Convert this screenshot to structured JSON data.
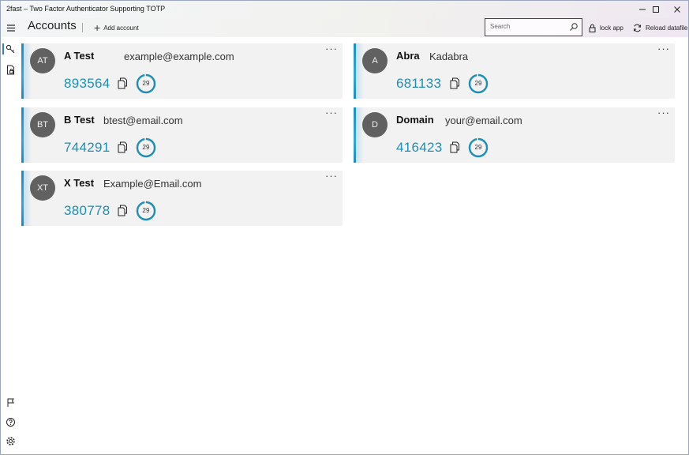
{
  "window": {
    "title": "2fast – Two Factor Authenticator Supporting TOTP"
  },
  "header": {
    "page_title": "Accounts",
    "add_account_label": "Add account",
    "search_placeholder": "Search",
    "lock_label": "lock app",
    "reload_label": "Reload datafile"
  },
  "colors": {
    "accent": "#1e8fb4",
    "avatar_bg": "#616161",
    "card_bg": "#f2f2f2"
  },
  "accounts": [
    {
      "initials": "AT",
      "label": "A Test",
      "account": "example@example.com",
      "code": "893564",
      "seconds": "29"
    },
    {
      "initials": "A",
      "label": "Abra",
      "account": "Kadabra",
      "code": "681133",
      "seconds": "29"
    },
    {
      "initials": "BT",
      "label": "B Test",
      "account": "btest@email.com",
      "code": "744291",
      "seconds": "29"
    },
    {
      "initials": "D",
      "label": "Domain",
      "account": "your@email.com",
      "code": "416423",
      "seconds": "29"
    },
    {
      "initials": "XT",
      "label": "X Test",
      "account": "Example@Email.com",
      "code": "380778",
      "seconds": "29"
    }
  ],
  "icons": {
    "more": "more-options-icon",
    "copy": "copy-icon",
    "timer": "timer-ring-icon"
  }
}
